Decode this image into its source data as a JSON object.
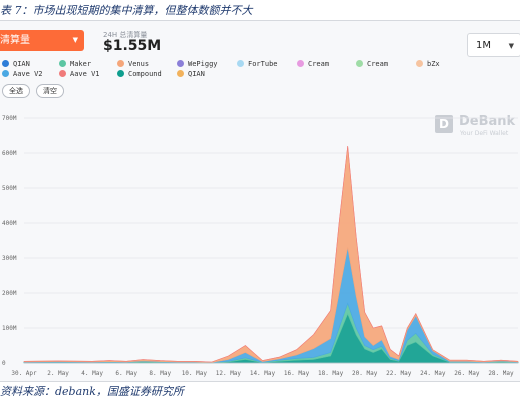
{
  "caption": "表 7：市场出现短期的集中清算，但整体数额并不大",
  "toolbar": {
    "metric_label": "清算量",
    "stat_label": "24H 总清算量",
    "stat_value": "$1.55M",
    "range_label": "1M"
  },
  "legend": [
    {
      "label": "QIAN",
      "color": "#2e7dd7"
    },
    {
      "label": "Maker",
      "color": "#5cc6a3"
    },
    {
      "label": "Venus",
      "color": "#f5a67a"
    },
    {
      "label": "WePiggy",
      "color": "#8b7fd8"
    },
    {
      "label": "ForTube",
      "color": "#a8d9f2"
    },
    {
      "label": "Cream",
      "color": "#e79be0"
    },
    {
      "label": "Cream",
      "color": "#9fdca6"
    },
    {
      "label": "bZx",
      "color": "#f6c4a0"
    },
    {
      "label": "Aave V2",
      "color": "#4aa8e3"
    },
    {
      "label": "Aave V1",
      "color": "#f07a7a"
    },
    {
      "label": "Compound",
      "color": "#0f9e8e"
    },
    {
      "label": "QIAN",
      "color": "#f2b25c"
    }
  ],
  "buttons": {
    "select_all": "全选",
    "clear": "清空"
  },
  "watermark": {
    "letter": "D",
    "name": "DeBank",
    "tagline": "Your DeFi Wallet"
  },
  "source": "资料来源：debank，国盛证券研究所",
  "chart_data": {
    "type": "area",
    "stacked": true,
    "y_unit": "M",
    "ylim": [
      0,
      700
    ],
    "yticks": [
      0,
      100,
      200,
      300,
      400,
      500,
      600,
      700
    ],
    "ytick_labels": [
      "0",
      "100M",
      "200M",
      "300M",
      "400M",
      "500M",
      "600M",
      "700M"
    ],
    "xlim": [
      0,
      29
    ],
    "x_ticks": [
      {
        "x": 0,
        "label": "30. Apr"
      },
      {
        "x": 2,
        "label": "2. May"
      },
      {
        "x": 4,
        "label": "4. May"
      },
      {
        "x": 6,
        "label": "6. May"
      },
      {
        "x": 8,
        "label": "8. May"
      },
      {
        "x": 10,
        "label": "10. May"
      },
      {
        "x": 12,
        "label": "12. May"
      },
      {
        "x": 14,
        "label": "14. May"
      },
      {
        "x": 16,
        "label": "16. May"
      },
      {
        "x": 18,
        "label": "18. May"
      },
      {
        "x": 20,
        "label": "20. May"
      },
      {
        "x": 22,
        "label": "22. May"
      },
      {
        "x": 24,
        "label": "24. May"
      },
      {
        "x": 26,
        "label": "26. May"
      },
      {
        "x": 28,
        "label": "28. May"
      }
    ],
    "grid": true,
    "x": [
      0,
      2,
      4,
      5,
      6,
      7,
      8,
      9,
      10,
      11,
      12,
      13,
      14,
      15,
      16,
      17,
      18,
      18.5,
      19,
      19.5,
      20,
      20.5,
      21,
      21.5,
      22,
      22.5,
      23,
      24,
      25,
      26,
      27,
      28,
      29
    ],
    "series": [
      {
        "name": "Compound",
        "color": "#0f9e8e",
        "values": [
          1,
          2,
          1,
          2,
          1,
          3,
          2,
          1,
          1,
          0.5,
          3,
          10,
          1,
          5,
          8,
          10,
          20,
          80,
          140,
          80,
          40,
          30,
          40,
          10,
          5,
          50,
          60,
          20,
          2,
          2,
          1,
          3,
          1
        ]
      },
      {
        "name": "Maker",
        "color": "#5cc6a3",
        "values": [
          1,
          1,
          1,
          1,
          1,
          2,
          1,
          1,
          1,
          0.5,
          2,
          5,
          1,
          3,
          5,
          6,
          10,
          20,
          30,
          20,
          10,
          8,
          8,
          3,
          2,
          15,
          25,
          5,
          1,
          1,
          1,
          2,
          1
        ]
      },
      {
        "name": "Aave V2",
        "color": "#4aa8e3",
        "values": [
          1,
          1,
          1,
          1,
          1,
          1,
          1,
          1,
          1,
          0.5,
          5,
          15,
          2,
          4,
          10,
          25,
          40,
          100,
          160,
          90,
          25,
          12,
          18,
          6,
          3,
          30,
          50,
          10,
          2,
          2,
          1,
          1,
          1
        ]
      },
      {
        "name": "Venus",
        "color": "#f5a67a",
        "values": [
          2,
          2,
          2,
          3,
          2,
          4,
          3,
          2,
          2,
          1,
          10,
          20,
          3,
          5,
          15,
          40,
          80,
          200,
          290,
          170,
          70,
          50,
          40,
          20,
          10,
          5,
          6,
          3,
          3,
          3,
          2,
          2,
          2
        ]
      },
      {
        "name": "Aave V1",
        "color": "#f07a7a",
        "values": [
          0,
          0,
          0,
          0,
          0,
          0,
          0,
          0,
          0,
          0,
          0,
          0,
          0,
          0,
          0,
          0,
          0,
          0,
          0,
          0,
          0,
          0,
          0,
          0,
          0,
          0,
          0,
          0,
          0,
          0,
          0,
          0,
          0
        ]
      }
    ]
  }
}
